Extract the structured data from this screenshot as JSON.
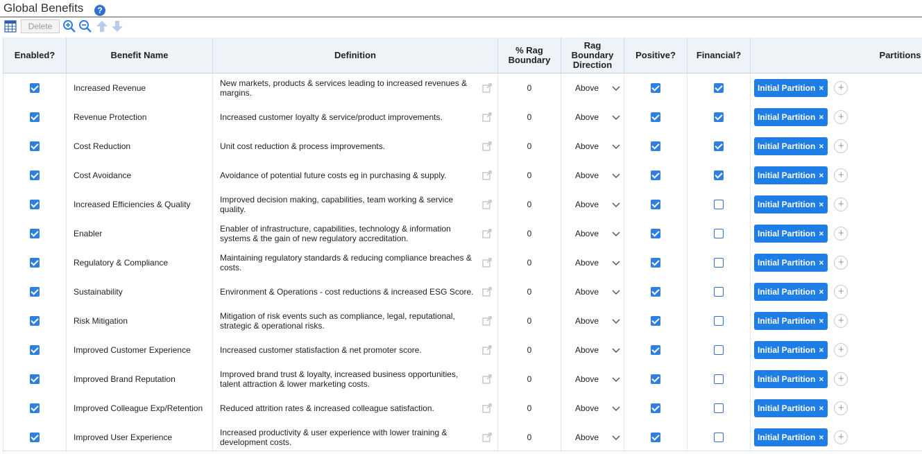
{
  "header": {
    "title": "Global Benefits",
    "help_label": "?"
  },
  "toolbar": {
    "delete_label": "Delete"
  },
  "columns": [
    "Enabled?",
    "Benefit Name",
    "Definition",
    "% Rag Boundary",
    "Rag Boundary Direction",
    "Positive?",
    "Financial?",
    "Partitions"
  ],
  "partition_label": "Initial Partition",
  "remove_label": "×",
  "add_label": "+",
  "colors": {
    "accent": "#1f7ee6",
    "header_bg": "#eef3f8"
  },
  "rows": [
    {
      "enabled": true,
      "name": "Increased Revenue",
      "definition": "New markets, products & services leading to increased revenues & margins.",
      "rag": "0",
      "direction": "Above",
      "positive": true,
      "financial": true
    },
    {
      "enabled": true,
      "name": "Revenue Protection",
      "definition": "Increased customer loyalty & service/product improvements.",
      "rag": "0",
      "direction": "Above",
      "positive": true,
      "financial": true
    },
    {
      "enabled": true,
      "name": "Cost Reduction",
      "definition": "Unit cost reduction & process improvements.",
      "rag": "0",
      "direction": "Above",
      "positive": true,
      "financial": true
    },
    {
      "enabled": true,
      "name": "Cost Avoidance",
      "definition": "Avoidance of potential future costs eg in purchasing & supply.",
      "rag": "0",
      "direction": "Above",
      "positive": true,
      "financial": true
    },
    {
      "enabled": true,
      "name": "Increased Efficiencies & Quality",
      "definition": "Improved decision making, capabilities, team working & service quality.",
      "rag": "0",
      "direction": "Above",
      "positive": true,
      "financial": false
    },
    {
      "enabled": true,
      "name": "Enabler",
      "definition": "Enabler of infrastructure, capabilities, technology & information systems & the gain of new regulatory accreditation.",
      "rag": "0",
      "direction": "Above",
      "positive": true,
      "financial": false
    },
    {
      "enabled": true,
      "name": "Regulatory & Compliance",
      "definition": "Maintaining regulatory standards & reducing compliance breaches & costs.",
      "rag": "0",
      "direction": "Above",
      "positive": true,
      "financial": false
    },
    {
      "enabled": true,
      "name": "Sustainability",
      "definition": "Environment & Operations - cost reductions & increased ESG Score.",
      "rag": "0",
      "direction": "Above",
      "positive": true,
      "financial": false
    },
    {
      "enabled": true,
      "name": "Risk Mitigation",
      "definition": "Mitigation of risk events such as compliance, legal, reputational, strategic & operational risks.",
      "rag": "0",
      "direction": "Above",
      "positive": true,
      "financial": false
    },
    {
      "enabled": true,
      "name": "Improved Customer Experience",
      "definition": "Increased customer statisfaction & net promoter score.",
      "rag": "0",
      "direction": "Above",
      "positive": true,
      "financial": false
    },
    {
      "enabled": true,
      "name": "Improved Brand Reputation",
      "definition": "Improved brand trust & loyalty, increased business opportunities, talent attraction & lower marketing costs.",
      "rag": "0",
      "direction": "Above",
      "positive": true,
      "financial": false
    },
    {
      "enabled": true,
      "name": "Improved Colleague Exp/Retention",
      "definition": "Reduced attrition rates & increased colleague satisfaction.",
      "rag": "0",
      "direction": "Above",
      "positive": true,
      "financial": false
    },
    {
      "enabled": true,
      "name": "Improved User Experience",
      "definition": "Increased productivity & user experience with lower training & development costs.",
      "rag": "0",
      "direction": "Above",
      "positive": true,
      "financial": false
    }
  ]
}
